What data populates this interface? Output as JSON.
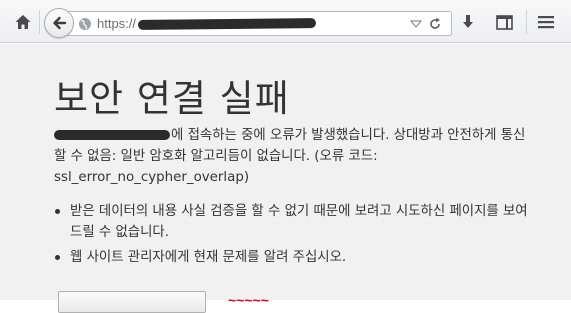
{
  "browser": {
    "url_prefix": "https://",
    "url_placeholder_icons": [
      "home-icon",
      "back-arrow-icon",
      "globe-icon",
      "dropdown-arrow-icon",
      "reload-icon",
      "download-icon",
      "sidebar-icon",
      "menu-icon"
    ]
  },
  "error_page": {
    "title": "보안 연결 실패",
    "description": "에 접속하는 중에 오류가 발생했습니다. 상대방과 안전하게 통신 할 수 없음: 일반 암호화 알고리듬이 없습니다. (오류 코드: ssl_error_no_cypher_overlap)",
    "bullets": [
      "받은 데이터의 내용 사실 검증을 할 수 없기 때문에 보려고 시도하신 페이지를 보여드릴 수 없습니다.",
      "웹 사이트 관리자에게 현재 문제를 알려 주십시오."
    ],
    "bottom_red_text": "~~~~~"
  },
  "colors": {
    "accent_red": "#d70022",
    "page_background": "#f1f1f1"
  }
}
